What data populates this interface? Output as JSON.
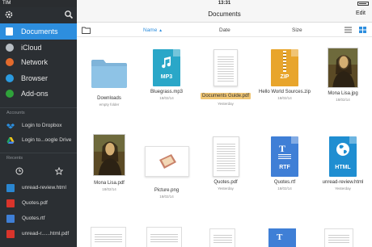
{
  "status": {
    "carrier": "TIM",
    "time": "13:31"
  },
  "sidebar": {
    "items": [
      {
        "label": "Documents",
        "color": "#2d8ede"
      },
      {
        "label": "iCloud",
        "color": "#b8bec4"
      },
      {
        "label": "Network",
        "color": "#e36b2d"
      },
      {
        "label": "Browser",
        "color": "#2b9be0"
      },
      {
        "label": "Add-ons",
        "color": "#2fa23a"
      }
    ],
    "accounts_title": "Accounts",
    "accounts": [
      {
        "label": "Login to Dropbox",
        "icon": "dropbox-icon"
      },
      {
        "label": "Login to...oogle Drive",
        "icon": "google-drive-icon"
      }
    ],
    "recents_title": "Recents",
    "recents": [
      {
        "label": "unread-review.html",
        "icon": "html-file-icon"
      },
      {
        "label": "Quotes.pdf",
        "icon": "pdf-file-icon"
      },
      {
        "label": "Quotes.rtf",
        "icon": "rtf-file-icon"
      },
      {
        "label": "unread-r......html.pdf",
        "icon": "pdf-file-icon"
      }
    ]
  },
  "main": {
    "title": "Documents",
    "edit_label": "Edit",
    "sort": {
      "name": "Name",
      "name_arrow": "▲",
      "date": "Date",
      "size": "Size"
    },
    "files": [
      {
        "name": "Downloads",
        "sub": "empty folder",
        "type": "folder"
      },
      {
        "name": "Bluegrass.mp3",
        "sub": "18/02/14",
        "type": "mp3",
        "label": "MP3"
      },
      {
        "name": "Documents Guide.pdf",
        "sub": "Yesterday",
        "type": "doc",
        "selected": true
      },
      {
        "name": "Hello World Sources.zip",
        "sub": "18/02/14",
        "type": "zip",
        "label": "ZIP"
      },
      {
        "name": "Mona Lisa.jpg",
        "sub": "18/02/14",
        "type": "image"
      },
      {
        "name": "Mona Lisa.pdf",
        "sub": "18/02/14",
        "type": "image"
      },
      {
        "name": "Picture.png",
        "sub": "18/02/14",
        "type": "png"
      },
      {
        "name": "Quotes.pdf",
        "sub": "Yesterday",
        "type": "doc"
      },
      {
        "name": "Quotes.rtf",
        "sub": "18/02/14",
        "type": "rtf",
        "label": "RTF"
      },
      {
        "name": "unread-review.html",
        "sub": "Yesterday",
        "type": "html",
        "label": "HTML"
      }
    ]
  }
}
